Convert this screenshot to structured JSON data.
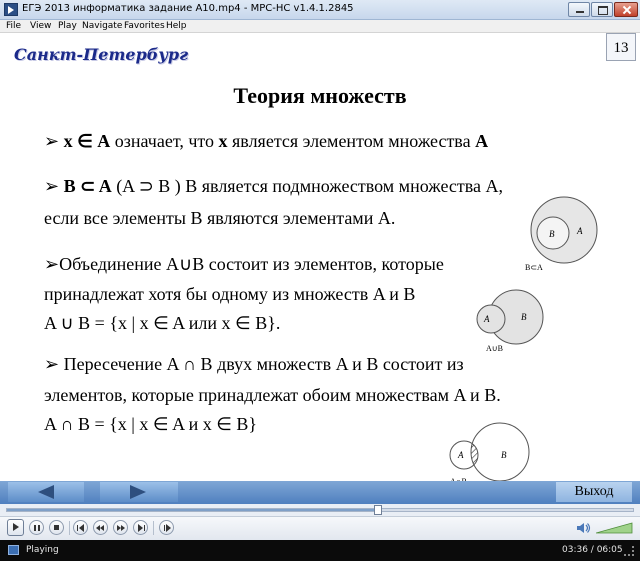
{
  "window": {
    "title": "ЕГЭ 2013 информатика задание А10.mp4 - MPC-HC v1.4.1.2845"
  },
  "menu": [
    "File",
    "View",
    "Play",
    "Navigate",
    "Favorites",
    "Help"
  ],
  "slide": {
    "city": "Санкт-Петербург",
    "number": "13",
    "title": "Теория множеств",
    "bullet1": {
      "arrow": "➢",
      "x": "x",
      "in": "∈",
      "a": "A",
      "text": " означает, что ",
      "x2": "x",
      "text2": " является элементом множества ",
      "a2": "A"
    },
    "bullet2": {
      "arrow": "➢",
      "bsubset": "B ⊂ A",
      "paren": " (A ⊃ B ) B является подмножеством множества A,",
      "line2": "если все элементы B являются элементами A."
    },
    "bullet3": {
      "line1": "➢Объединение A∪B состоит из элементов, которые",
      "line2": "принадлежат хотя бы одному из множеств A и B",
      "line3": "A ∪ B = {x | x ∈ A или x ∈ B}."
    },
    "bullet4": {
      "line1": "➢ Пересечение A ∩ B двух множеств A и B состоит из",
      "line2": "элементов, которые принадлежат обоим множествам A и B.",
      "line3": "A ∩ B = {x | x ∈ A и x ∈ B}"
    },
    "diagrams": {
      "subset": {
        "outer": "A",
        "inner": "B",
        "caption": "B⊂A"
      },
      "union": {
        "left": "A",
        "right": "B",
        "caption": "A∪B"
      },
      "intersection": {
        "left": "A",
        "right": "B",
        "caption": "A∩B"
      }
    },
    "nav": {
      "exit_label": "Выход"
    }
  },
  "player": {
    "seek_fraction": 0.592,
    "status": "Playing",
    "time": "03:36 / 06:05"
  },
  "icons": [
    "play-icon",
    "pause-icon",
    "stop-icon",
    "prev-icon",
    "rewind-icon",
    "fast-forward-icon",
    "next-icon",
    "frame-step-icon",
    "speaker-icon"
  ]
}
